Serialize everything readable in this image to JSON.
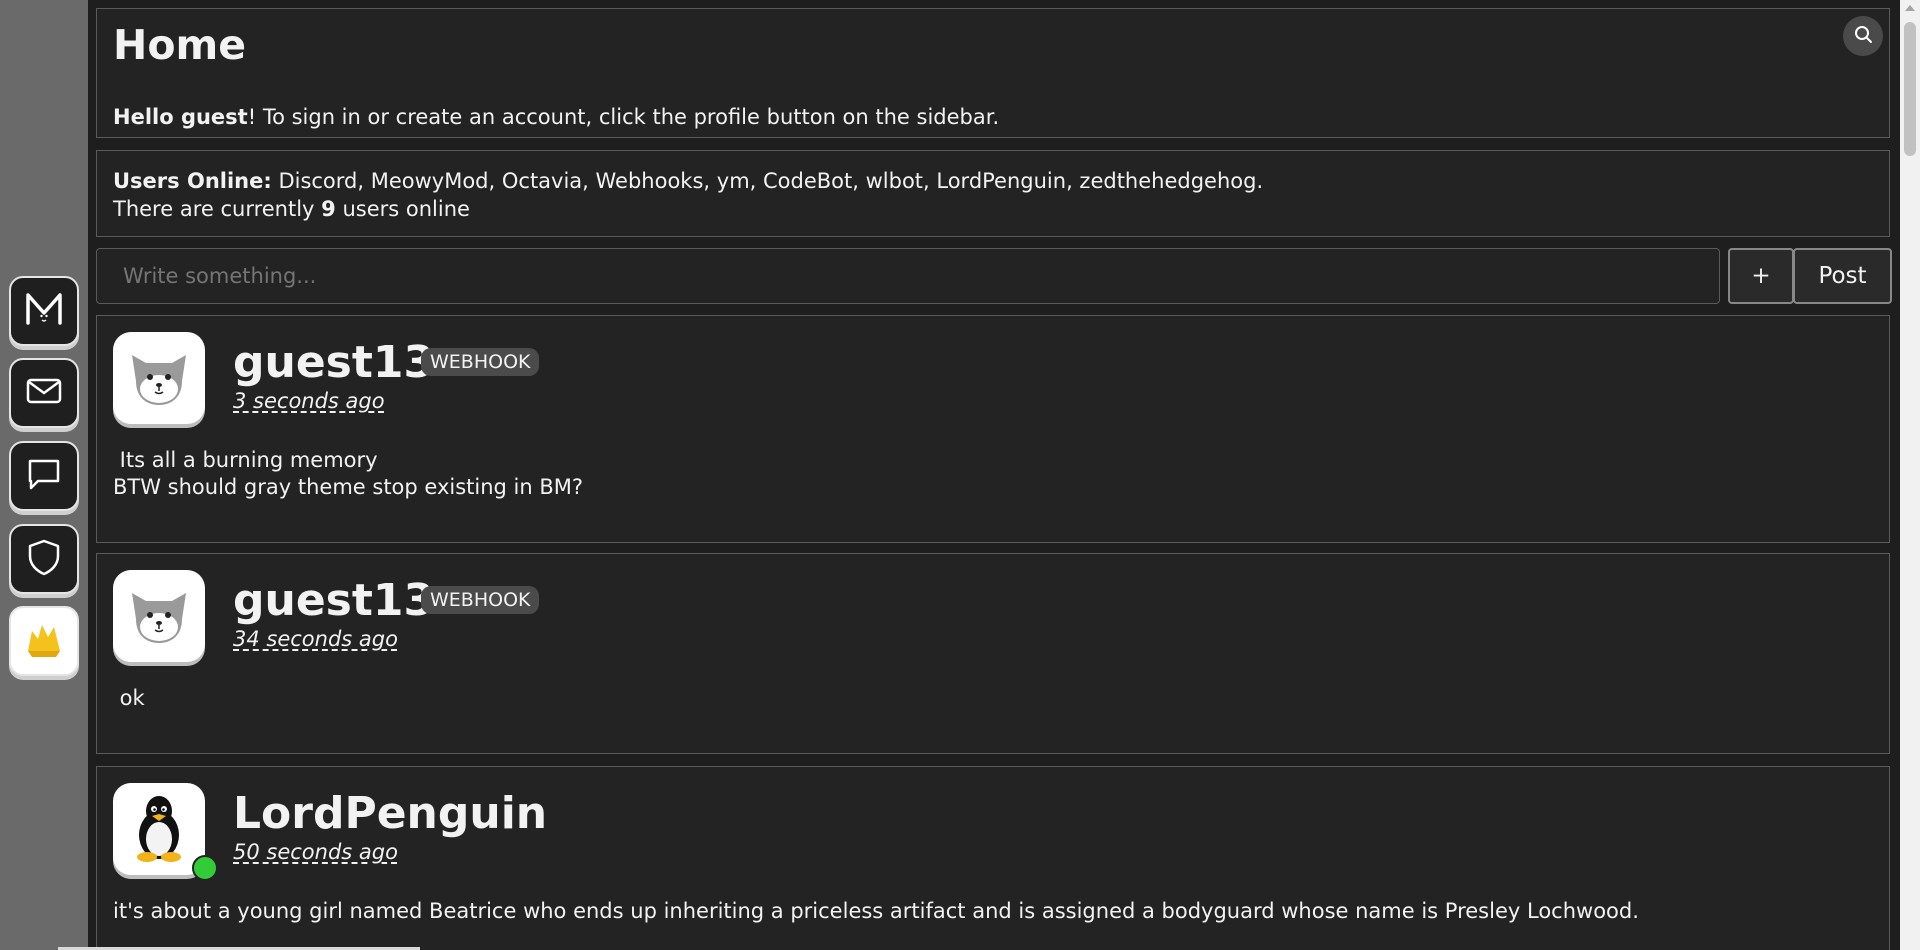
{
  "header": {
    "title": "Home",
    "greeting_bold": "Hello guest",
    "greeting_rest": "! To sign in or create an account, click the profile button on the sidebar."
  },
  "online": {
    "label": "Users Online:",
    "users": " Discord, MeowyMod, Octavia, Webhooks, ym, CodeBot, wlbot, LordPenguin, zedthehedgehog.",
    "prefix": "There are currently ",
    "count": "9",
    "suffix": " users online"
  },
  "composer": {
    "placeholder": "Write something...",
    "plus_label": "+",
    "post_label": "Post"
  },
  "sidebar": {
    "items": [
      {
        "icon": "meower-logo-icon"
      },
      {
        "icon": "mail-icon"
      },
      {
        "icon": "chat-bubble-icon"
      },
      {
        "icon": "shield-icon"
      },
      {
        "icon": "profile-icon"
      }
    ]
  },
  "posts": [
    {
      "username": "guest13",
      "badge": "WEBHOOK",
      "time": "3 seconds ago",
      "text": " Its all a burning memory\nBTW should gray theme stop existing in BM?",
      "avatar": "cat-avatar-icon"
    },
    {
      "username": "guest13",
      "badge": "WEBHOOK",
      "time": "34 seconds ago",
      "text": " ok",
      "avatar": "cat-avatar-icon"
    },
    {
      "username": "LordPenguin",
      "badge": "",
      "time": "50 seconds ago",
      "text": "it's about a young girl named Beatrice who ends up inheriting a priceless artifact and is assigned a bodyguard whose name is Presley Lochwood.",
      "avatar": "penguin-avatar-icon",
      "online": true
    }
  ],
  "colors": {
    "background": "#1e1e1e",
    "card": "#232323",
    "sidebar": "#6a6a6a",
    "online_dot": "#31cc37"
  }
}
